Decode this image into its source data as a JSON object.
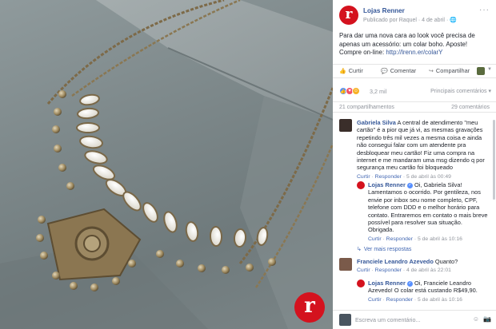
{
  "photo": {
    "alt_icon": "lojas-renner-r-logo",
    "logo_letter": "r",
    "brand_color": "#d4121e"
  },
  "post": {
    "page_avatar_letter": "r",
    "page_name": "Lojas Renner",
    "date": "Publicado por Raquel · 4 de abril",
    "globe_icon": "globe-icon",
    "text_prefix": "Para dar uma nova cara ao look você precisa de apenas um acessório: um colar boho. Aposte! Compre on-line: ",
    "text_link": "http://lrenn.er/colarY"
  },
  "actions": {
    "like": "Curtir",
    "comment": "Comentar",
    "share": "Compartilhar"
  },
  "reactions": {
    "count": "3,2 mil",
    "sort": "Principais comentários ▾"
  },
  "stats": {
    "shares": "21 compartilhamentos",
    "comments": "29 comentários"
  },
  "comments": [
    {
      "author": "Gabriela Silva",
      "text": "A central de atendimento \"meu cartão\" é a pior que já vi, as mesmas gravações repetindo três mil vezes a mesma coisa e ainda não consegui falar com um atendente pra desbloquear meu cartão! Fiz uma compra na internet e me mandaram uma msg dizendo q por segurança meu cartão foi bloqueado",
      "meta_like": "Curtir",
      "meta_reply": "Responder",
      "meta_time": "5 de abril às 00:49"
    }
  ],
  "replies": [
    {
      "author": "Lojas Renner",
      "text": "Oi, Gabriela Silva! Lamentamos o ocorrido. Por gentileza, nos envie por inbox seu nome completo, CPF, telefone com DDD e o melhor horário para contato. Entraremos em contato o mais breve possível para resolver sua situação. Obrigada.",
      "meta_like": "Curtir",
      "meta_reply": "Responder",
      "meta_time": "5 de abril às 10:16"
    },
    {
      "author": "Lojas Renner",
      "text": "Oi, Franciele Leandro Azevedo! O colar está custando R$49,90.",
      "meta_like": "Curtir",
      "meta_reply": "Responder",
      "meta_time": "5 de abril às 10:16"
    }
  ],
  "more_replies": "Ver mais respostas",
  "comment2": {
    "author": "Franciele Leandro Azevedo",
    "text": "Quanto?",
    "meta_like": "Curtir",
    "meta_reply": "Responder",
    "meta_time": "4 de abril às 22:01"
  },
  "composer": {
    "placeholder": "Escreva um comentário..."
  }
}
